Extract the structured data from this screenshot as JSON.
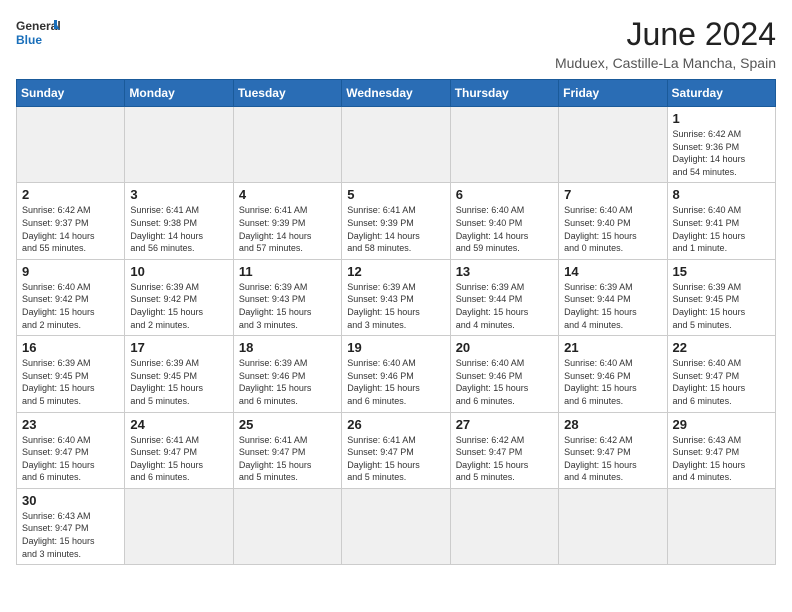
{
  "logo": {
    "line1": "General",
    "line2": "Blue"
  },
  "title": "June 2024",
  "location": "Muduex, Castille-La Mancha, Spain",
  "days_of_week": [
    "Sunday",
    "Monday",
    "Tuesday",
    "Wednesday",
    "Thursday",
    "Friday",
    "Saturday"
  ],
  "weeks": [
    [
      {
        "day": "",
        "info": ""
      },
      {
        "day": "",
        "info": ""
      },
      {
        "day": "",
        "info": ""
      },
      {
        "day": "",
        "info": ""
      },
      {
        "day": "",
        "info": ""
      },
      {
        "day": "",
        "info": ""
      },
      {
        "day": "1",
        "info": "Sunrise: 6:42 AM\nSunset: 9:36 PM\nDaylight: 14 hours\nand 54 minutes."
      }
    ],
    [
      {
        "day": "2",
        "info": "Sunrise: 6:42 AM\nSunset: 9:37 PM\nDaylight: 14 hours\nand 55 minutes."
      },
      {
        "day": "3",
        "info": "Sunrise: 6:41 AM\nSunset: 9:38 PM\nDaylight: 14 hours\nand 56 minutes."
      },
      {
        "day": "4",
        "info": "Sunrise: 6:41 AM\nSunset: 9:39 PM\nDaylight: 14 hours\nand 57 minutes."
      },
      {
        "day": "5",
        "info": "Sunrise: 6:41 AM\nSunset: 9:39 PM\nDaylight: 14 hours\nand 58 minutes."
      },
      {
        "day": "6",
        "info": "Sunrise: 6:40 AM\nSunset: 9:40 PM\nDaylight: 14 hours\nand 59 minutes."
      },
      {
        "day": "7",
        "info": "Sunrise: 6:40 AM\nSunset: 9:40 PM\nDaylight: 15 hours\nand 0 minutes."
      },
      {
        "day": "8",
        "info": "Sunrise: 6:40 AM\nSunset: 9:41 PM\nDaylight: 15 hours\nand 1 minute."
      }
    ],
    [
      {
        "day": "9",
        "info": "Sunrise: 6:40 AM\nSunset: 9:42 PM\nDaylight: 15 hours\nand 2 minutes."
      },
      {
        "day": "10",
        "info": "Sunrise: 6:39 AM\nSunset: 9:42 PM\nDaylight: 15 hours\nand 2 minutes."
      },
      {
        "day": "11",
        "info": "Sunrise: 6:39 AM\nSunset: 9:43 PM\nDaylight: 15 hours\nand 3 minutes."
      },
      {
        "day": "12",
        "info": "Sunrise: 6:39 AM\nSunset: 9:43 PM\nDaylight: 15 hours\nand 3 minutes."
      },
      {
        "day": "13",
        "info": "Sunrise: 6:39 AM\nSunset: 9:44 PM\nDaylight: 15 hours\nand 4 minutes."
      },
      {
        "day": "14",
        "info": "Sunrise: 6:39 AM\nSunset: 9:44 PM\nDaylight: 15 hours\nand 4 minutes."
      },
      {
        "day": "15",
        "info": "Sunrise: 6:39 AM\nSunset: 9:45 PM\nDaylight: 15 hours\nand 5 minutes."
      }
    ],
    [
      {
        "day": "16",
        "info": "Sunrise: 6:39 AM\nSunset: 9:45 PM\nDaylight: 15 hours\nand 5 minutes."
      },
      {
        "day": "17",
        "info": "Sunrise: 6:39 AM\nSunset: 9:45 PM\nDaylight: 15 hours\nand 5 minutes."
      },
      {
        "day": "18",
        "info": "Sunrise: 6:39 AM\nSunset: 9:46 PM\nDaylight: 15 hours\nand 6 minutes."
      },
      {
        "day": "19",
        "info": "Sunrise: 6:40 AM\nSunset: 9:46 PM\nDaylight: 15 hours\nand 6 minutes."
      },
      {
        "day": "20",
        "info": "Sunrise: 6:40 AM\nSunset: 9:46 PM\nDaylight: 15 hours\nand 6 minutes."
      },
      {
        "day": "21",
        "info": "Sunrise: 6:40 AM\nSunset: 9:46 PM\nDaylight: 15 hours\nand 6 minutes."
      },
      {
        "day": "22",
        "info": "Sunrise: 6:40 AM\nSunset: 9:47 PM\nDaylight: 15 hours\nand 6 minutes."
      }
    ],
    [
      {
        "day": "23",
        "info": "Sunrise: 6:40 AM\nSunset: 9:47 PM\nDaylight: 15 hours\nand 6 minutes."
      },
      {
        "day": "24",
        "info": "Sunrise: 6:41 AM\nSunset: 9:47 PM\nDaylight: 15 hours\nand 6 minutes."
      },
      {
        "day": "25",
        "info": "Sunrise: 6:41 AM\nSunset: 9:47 PM\nDaylight: 15 hours\nand 5 minutes."
      },
      {
        "day": "26",
        "info": "Sunrise: 6:41 AM\nSunset: 9:47 PM\nDaylight: 15 hours\nand 5 minutes."
      },
      {
        "day": "27",
        "info": "Sunrise: 6:42 AM\nSunset: 9:47 PM\nDaylight: 15 hours\nand 5 minutes."
      },
      {
        "day": "28",
        "info": "Sunrise: 6:42 AM\nSunset: 9:47 PM\nDaylight: 15 hours\nand 4 minutes."
      },
      {
        "day": "29",
        "info": "Sunrise: 6:43 AM\nSunset: 9:47 PM\nDaylight: 15 hours\nand 4 minutes."
      }
    ],
    [
      {
        "day": "30",
        "info": "Sunrise: 6:43 AM\nSunset: 9:47 PM\nDaylight: 15 hours\nand 3 minutes."
      },
      {
        "day": "",
        "info": ""
      },
      {
        "day": "",
        "info": ""
      },
      {
        "day": "",
        "info": ""
      },
      {
        "day": "",
        "info": ""
      },
      {
        "day": "",
        "info": ""
      },
      {
        "day": "",
        "info": ""
      }
    ]
  ]
}
